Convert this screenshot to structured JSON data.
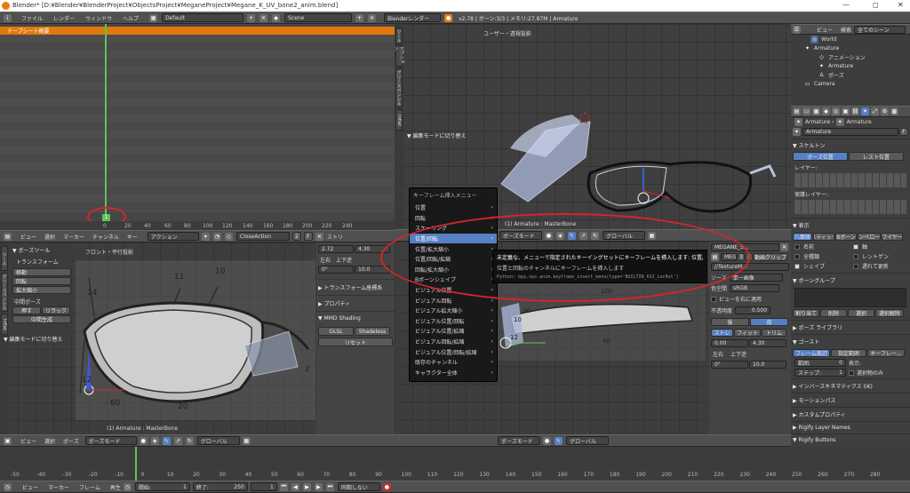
{
  "title": "Blender* [D:¥Blender¥BlenderProject¥ObjectsProject¥MeganeProject¥Megane_K_UV_bone2_anim.blend]",
  "window_controls": {
    "min": "—",
    "max": "◻",
    "close": "✕"
  },
  "topbar": {
    "menus": [
      "ファイル",
      "レンダー",
      "ウィンドウ",
      "ヘルプ"
    ],
    "layout": "Default",
    "scene": "Scene",
    "renderer": "Blenderレンダー",
    "version": "v2.78 | ボーン:3/3 | メモリ:27.87M | Armature"
  },
  "dopesheet": {
    "summary": "ドープシート概要",
    "frame_badge": "1",
    "ticks": [
      "0",
      "20",
      "40",
      "60",
      "80",
      "100",
      "120",
      "140",
      "160",
      "180",
      "200",
      "220",
      "240"
    ]
  },
  "action_header": {
    "menus": [
      "ビュー",
      "選択",
      "マーカー",
      "チャンネル",
      "キー"
    ],
    "mode": "アクション",
    "action_name": "CloseAction",
    "users": "2",
    "f": "F",
    "btn": "ストリ"
  },
  "left_3d": {
    "view_label": "フロント・平行投影",
    "bottom_label": "(1) Armature : MasterBone",
    "pose_tool_title": "▼ ポーズツール",
    "transform": "トランスフォーム",
    "t_btns": [
      "移動",
      "回転",
      "拡大縮小"
    ],
    "middle_pose": "中間ポーズ",
    "mid_btns": [
      "押す",
      "リラック"
    ],
    "mid_gen": "中間生成",
    "edit_toggle": "▼ 編集モードに切り替え",
    "drawing_labels": [
      "14",
      "11",
      "10",
      "12",
      "60",
      "20",
      "2"
    ],
    "tabs": [
      "ツール",
      "グリースペンシル",
      "Inflat"
    ]
  },
  "left_props": {
    "field1": "2.72",
    "field2": "4.30",
    "lr": "左右",
    "ud": "上下逆",
    "rot": "0°",
    "scale": "10.0",
    "sections": [
      "▶ トランスフォーム座標系",
      "▶ プロパティ",
      "▼ MMD Shading"
    ],
    "glsl": "GLSL",
    "shadeless": "Shadeless",
    "reset": "リセット"
  },
  "left_footer": {
    "menus": [
      "ビュー",
      "選択",
      "ポーズ"
    ],
    "mode": "ポーズモード",
    "orient": "グローバル"
  },
  "right_3d": {
    "view_label": "ユーザー・透視投影",
    "bottom_label": "(1) Armature : MasterBone",
    "tabs": [
      "ツール",
      "オプション",
      "グリースペンシル",
      "Inflat"
    ],
    "edit_toggle": "▼ 編集モードに切り替え",
    "mode": "ポーズモード",
    "orient": "グローバル",
    "drawing_labels": [
      "100",
      "30",
      "10",
      "40",
      "12"
    ],
    "img_name": "MEGANE_S...",
    "slot": "MEG",
    "slot_num": "3",
    "f": "F",
    "anim_clip": "動画クリップ",
    "texture": "//TextureM...",
    "source_label": "ソース",
    "source": "単一画像",
    "colorspace_label": "色空間",
    "colorspace": "sRGB",
    "view_as": "ビューを右に適用",
    "opacity_label": "不透明度",
    "opacity": "0.500",
    "back": "後",
    "front": "前",
    "stretch": "ストレ",
    "fit": "フィット",
    "trim": "トリム",
    "v1": "0.00",
    "v2": "4.30",
    "lr": "左右",
    "ud": "上下逆",
    "rot": "0°",
    "scale": "10.0"
  },
  "context_menu": {
    "title": "キーフレーム挿入メニュー",
    "items": [
      "位置",
      "回転",
      "スケーリング",
      "位置/回転",
      "位置/拡大縮小",
      "位置/回転/拡縮",
      "回転/拡大縮小",
      "Bボーンシェイプ",
      "ビジュアル位置",
      "ビジュアル回転",
      "ビジュアル拡大縮小",
      "ビジュアル位置/回転",
      "ビジュアル位置/拡縮",
      "ビジュアル回転/拡縮",
      "ビジュアル位置/回転/拡縮",
      "既存のチャンネル",
      "キャラクター全体"
    ],
    "highlight_index": 3
  },
  "tooltip": {
    "line1": "未定義な、メニューで指定されたキーイングセットにキーフレームを挿入します: 位置/回転",
    "line2": "位置と回転のチャンネルにキーフレームを挿入します",
    "line3": "Python: bpy.ops.anim.keyframe_insert_menu(type='BUILTIN_KSI_LocRot')"
  },
  "outliner": {
    "tabs": [
      "ビュー",
      "検索"
    ],
    "scene_sel": "全てのシーン",
    "items": [
      "World",
      "Armature",
      "アニメーション",
      "Armature",
      "ポーズ",
      "Camera"
    ]
  },
  "properties": {
    "breadcrumb": "Armature",
    "name": "Armature",
    "f": "F",
    "skeleton": "▼ スケルトン",
    "pose_pos": "ポーズ位置",
    "rest_pos": "レスト位置",
    "layer_label": "レイヤー:",
    "protect_label": "保護レイヤー:",
    "display": "▼ 表示",
    "disp_btns": [
      "八面体",
      "スティック",
      "Bボーン",
      "エンベロープ",
      "ワイヤー"
    ],
    "checks": [
      [
        "名前",
        "軸"
      ],
      [
        "全種類",
        "レントゲン"
      ],
      [
        "シェイプ",
        "遅れて更新"
      ]
    ],
    "bone_group": "▼ ボーングループ",
    "assign": "割り当て",
    "remove": "削除",
    "select": "選択",
    "deselect": "選択解除",
    "pose_library": "▶ ポーズ ライブラリ",
    "ghost": "▼ ゴースト",
    "ghost_tabs": [
      "フレーム周辺",
      "指定範囲",
      "キーフレー..."
    ],
    "range_label": "範囲:",
    "range_val": "0",
    "display_label": "表示:",
    "step_label": "ステップ:",
    "step_val": "1",
    "sel_only": "選択物のみ",
    "ik": "▶ インバースキネマティクス (iK)",
    "motion_path": "▶ モーションパス",
    "custom_props": "▶ カスタムプロパティ",
    "rigify_layers": "▶ Rigify Layer Names",
    "rigify_buttons": "▼ Rigify Buttons",
    "generate": "生成"
  },
  "timeline": {
    "ticks": [
      "-50",
      "-40",
      "-30",
      "-20",
      "-10",
      "0",
      "10",
      "20",
      "30",
      "40",
      "50",
      "60",
      "70",
      "80",
      "90",
      "100",
      "110",
      "120",
      "130",
      "140",
      "150",
      "160",
      "170",
      "180",
      "190",
      "200",
      "210",
      "220",
      "230",
      "240",
      "250",
      "260",
      "270",
      "280"
    ],
    "menus": [
      "ビュー",
      "マーカー",
      "フレーム",
      "再生"
    ],
    "start_label": "開始:",
    "start": "1",
    "end_label": "終了:",
    "end": "250",
    "current": "1",
    "sync": "同期しない"
  }
}
